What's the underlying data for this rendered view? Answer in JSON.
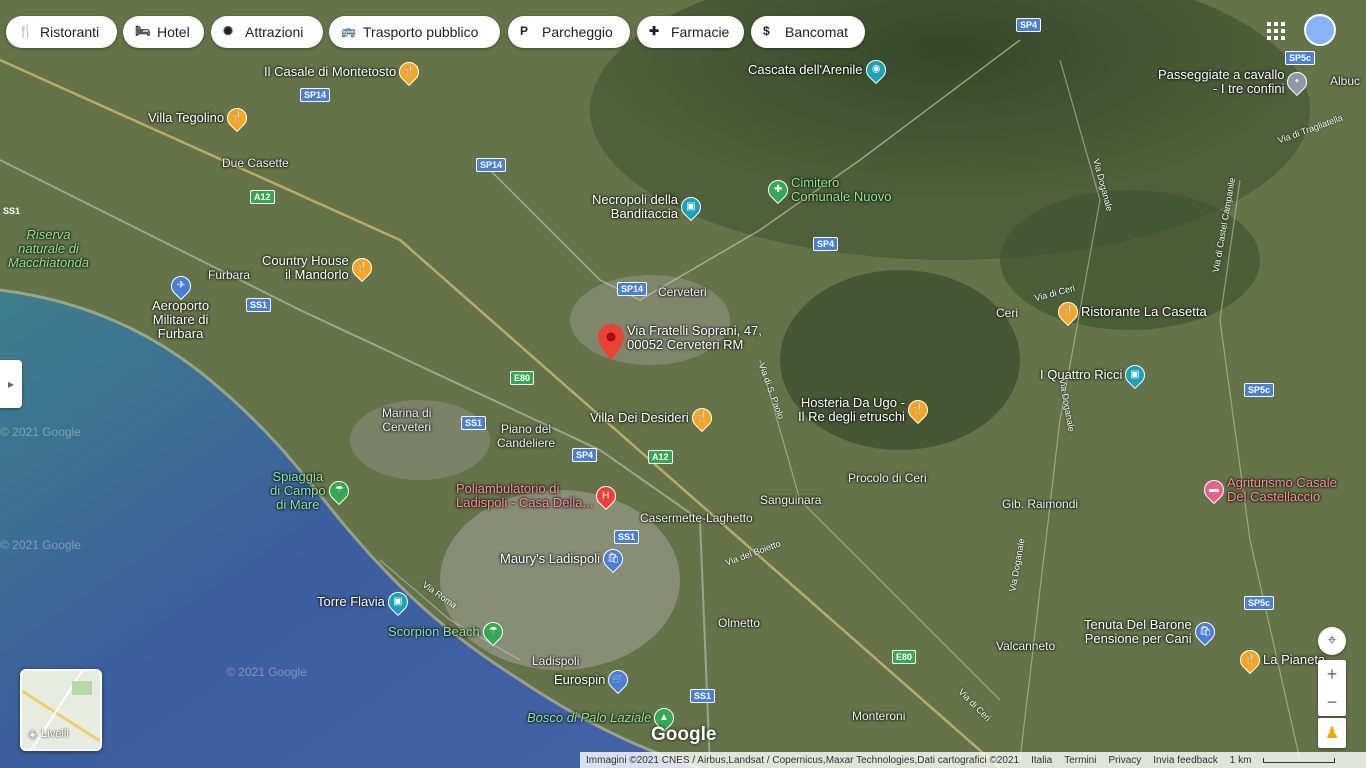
{
  "chips": [
    {
      "label": "Ristoranti",
      "icon": "restaurant-icon"
    },
    {
      "label": "Hotel",
      "icon": "bed-icon"
    },
    {
      "label": "Attrazioni",
      "icon": "attraction-icon"
    },
    {
      "label": "Trasporto pubblico",
      "icon": "transit-icon"
    },
    {
      "label": "Parcheggio",
      "icon": "parking-icon"
    },
    {
      "label": "Farmacie",
      "icon": "pharmacy-icon"
    },
    {
      "label": "Bancomat",
      "icon": "atm-icon"
    }
  ],
  "places": {
    "casale": "Il Casale di Montetosto",
    "tegolino": "Villa Tegolino",
    "due_casette": "Due Casette",
    "cascata": "Cascata dell'Arenile",
    "passeggiate": "Passeggiate a cavallo\n- I tre confini",
    "albuc": "Albuc",
    "riserva": "Riserva\nnaturale di\nMacchiatonda",
    "necropoli": "Necropoli della\nBanditaccia",
    "cimitero": "Cimitero\nComunale Nuovo",
    "furbara": "Furbara",
    "country": "Country House\nil Mandorlo",
    "cerveteri": "Cerveteri",
    "aeroporto": "Aeroporto\nMilitare di\nFurbara",
    "ceri": "Ceri",
    "casetta": "Ristorante La Casetta",
    "marker_address": "Via Fratelli Soprani, 47,\n00052 Cerveteri RM",
    "quattro_ricci": "I Quattro Ricci",
    "marina": "Marina di\nCerveteri",
    "piano": "Piano del\nCandeliere",
    "desideri": "Villa Dei Desideri",
    "hosteria": "Hosteria Da Ugo -\nIl Re degli etruschi",
    "procolo": "Procolo di Ceri",
    "agriturismo": "Agriturismo Casale\nDel Castellaccio",
    "sanguinara": "Sanguinara",
    "raimondi": "Gib. Raimondi",
    "spiaggia": "Spiaggia\ndi Campo\ndi Mare",
    "poliambulatorio": "Poliambulatorio di\nLadispoli - Casa Della...",
    "casermette": "Casermette-Laghetto",
    "maurys": "Maury's Ladispoli",
    "torre": "Torre Flavia",
    "olmetto": "Olmetto",
    "scorpion": "Scorpion Beach",
    "ladispoli": "Ladispoli",
    "tenuta": "Tenuta Del Barone\nPensione per Cani",
    "valcanneto": "Valcanneto",
    "pianeta": "La Pianeta",
    "eurospin": "Eurospin",
    "bosco": "Bosco di Palo Laziale",
    "monteroni": "Monteroni"
  },
  "roads": {
    "sp4": "SP4",
    "sp14": "SP14",
    "a12": "A12",
    "ss1": "SS1",
    "e80": "E80",
    "sp5c": "SP5c",
    "via_dogana": "Via Doganale",
    "via_s_paolo": "Via di S. Paolo",
    "via_roma": "Via Roma",
    "via_boietto": "Via del Boietto",
    "via_ceri": "Via di Ceri",
    "via_castel": "Via di Castel Campanile",
    "via_tragliatella": "Via di Tragliatella"
  },
  "watermark": "© 2021 Google",
  "layers_label": "Livelli",
  "google_logo": "Google",
  "footer": {
    "imagery": "Immagini ©2021 CNES / Airbus,Landsat / Copernicus,Maxar Technologies,Dati cartografici ©2021",
    "country": "Italia",
    "terms": "Termini",
    "privacy": "Privacy",
    "feedback": "Invia feedback",
    "scale": "1 km"
  },
  "colors": {
    "sea": "#3f6fa6",
    "land": "#5c6f45",
    "marker": "#ea4335",
    "restaurant": "#f5a623",
    "attraction": "#1ba2b8",
    "park": "#34a853",
    "hotel": "#e8608b",
    "shop": "#4a7fd8"
  }
}
